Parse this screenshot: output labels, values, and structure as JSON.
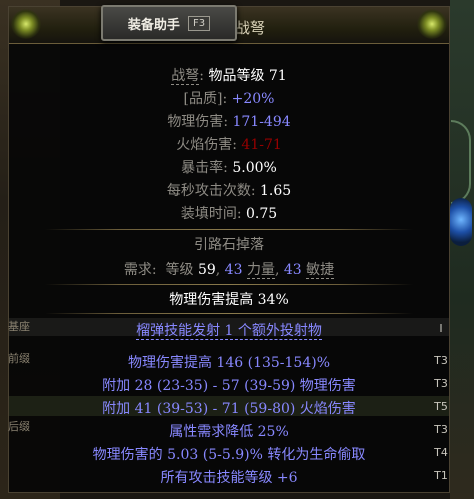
{
  "helper": {
    "label": "装备助手",
    "hotkey": "F3"
  },
  "item": {
    "name_partial": "战弩"
  },
  "properties": [
    {
      "label": "战弩",
      "sep": ": ",
      "value": "物品等级 71"
    },
    {
      "label": "[品质]",
      "sep": ": ",
      "value": "+20%"
    },
    {
      "label": "物理伤害",
      "sep": ": ",
      "value": "171-494"
    },
    {
      "label": "火焰伤害",
      "sep": ": ",
      "value": "41-71"
    },
    {
      "label": "暴击率",
      "sep": ": ",
      "value": "5.00%"
    },
    {
      "label": "每秒攻击次数",
      "sep": ": ",
      "value": "1.65"
    },
    {
      "label": "装填时间",
      "sep": ": ",
      "value": "0.75"
    }
  ],
  "group_title": "引路石掉落",
  "requirements": {
    "label": "需求",
    "level_label": "等级",
    "level": "59",
    "str": "43",
    "str_label": "力量",
    "dex": "43",
    "dex_label": "敏捷"
  },
  "implicit": "物理伤害提高 34%",
  "modifiers": [
    {
      "text": "榴弹技能发射 1 个额外投射物",
      "tier": "I"
    },
    {
      "text": "物理伤害提高 146 (135-154)%",
      "tier": "T3"
    },
    {
      "text": "附加 28 (23-35) - 57 (39-59) 物理伤害",
      "tier": "T3"
    },
    {
      "text": "附加 41 (39-53) - 71 (59-80) 火焰伤害",
      "tier": "T5"
    },
    {
      "text": "属性需求降低 25%",
      "tier": "T3"
    },
    {
      "text": "物理伤害的 5.03 (5-5.9)% 转化为生命偷取",
      "tier": "T4"
    },
    {
      "text": "所有攻击技能等级 +6",
      "tier": "T1"
    }
  ],
  "side_labels": [
    "基座",
    "前缀",
    "后缀"
  ]
}
